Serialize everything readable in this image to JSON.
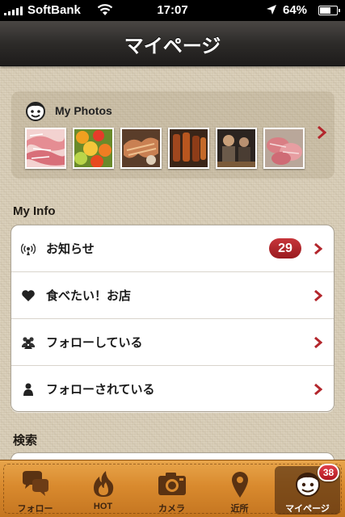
{
  "status_bar": {
    "carrier": "SoftBank",
    "time": "17:07",
    "battery": "64%",
    "battery_level": 0.64
  },
  "nav": {
    "title": "マイページ"
  },
  "photos": {
    "title": "My Photos",
    "thumbnails": [
      {
        "name": "sashimi-pink",
        "color": "#e79a9c"
      },
      {
        "name": "fruit-salad",
        "color": "#e9a52a"
      },
      {
        "name": "grilled-shrimp",
        "color": "#8a5a3b"
      },
      {
        "name": "yakitori",
        "color": "#7a3d1f"
      },
      {
        "name": "people-at-table",
        "color": "#3a2f28"
      },
      {
        "name": "meat-platter",
        "color": "#d9868a"
      }
    ]
  },
  "my_info": {
    "label": "My Info",
    "items": [
      {
        "label": "お知らせ",
        "icon": "broadcast-icon",
        "badge": "29"
      },
      {
        "label": "食べたい！お店",
        "icon": "heart-icon",
        "badge": ""
      },
      {
        "label": "フォローしている",
        "icon": "group-icon",
        "badge": ""
      },
      {
        "label": "フォローされている",
        "icon": "person-icon",
        "badge": ""
      }
    ]
  },
  "search": {
    "label": "検索"
  },
  "tabs": [
    {
      "label": "フォロー",
      "icon": "speech-bubbles-icon"
    },
    {
      "label": "HOT",
      "icon": "flame-icon"
    },
    {
      "label": "カメラ",
      "icon": "camera-icon"
    },
    {
      "label": "近所",
      "icon": "location-pin-icon"
    },
    {
      "label": "マイページ",
      "icon": "face-icon",
      "active": true
    }
  ],
  "tab_badge": "38",
  "colors": {
    "accent_red": "#b3262c",
    "tab_orange": "#d98a2e",
    "nav_dark": "#2d2b29"
  }
}
